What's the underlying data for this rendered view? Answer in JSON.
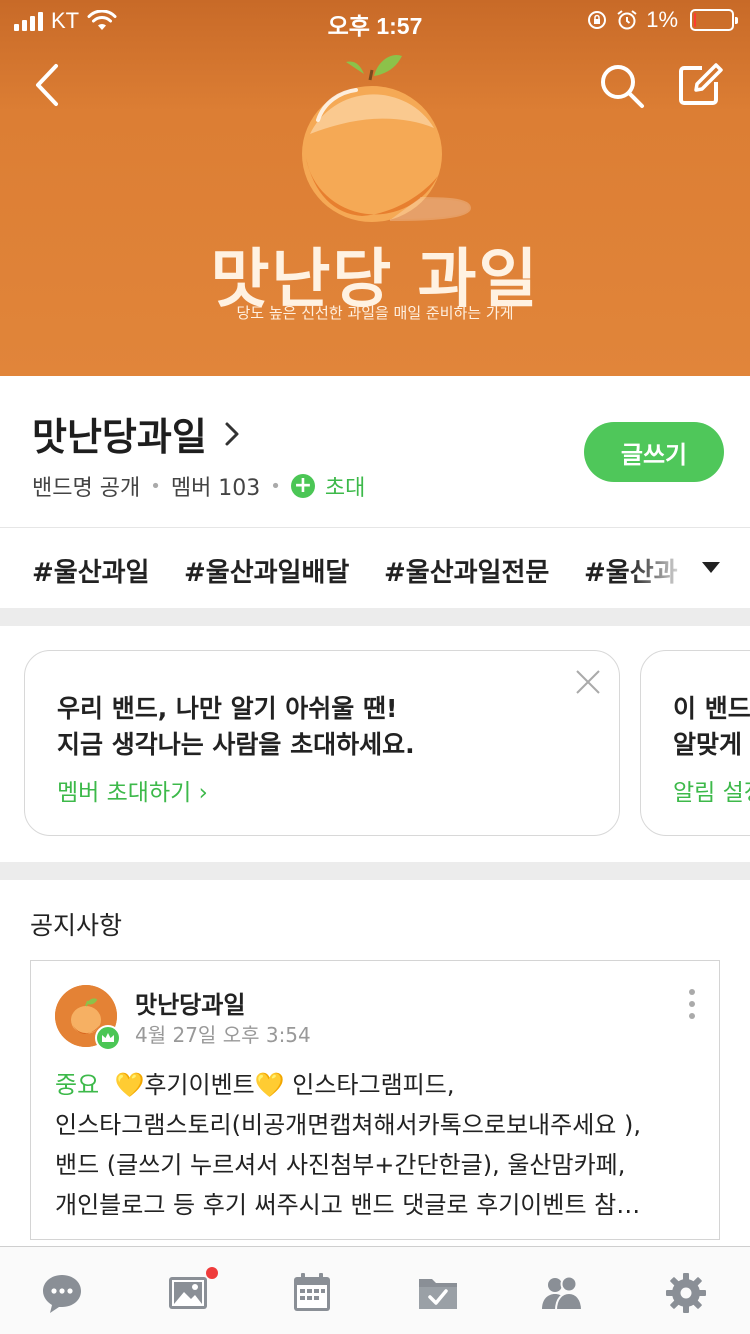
{
  "status_bar": {
    "carrier": "KT",
    "time": "오후 1:57",
    "battery": "1%"
  },
  "cover": {
    "title": "맛난당 과일",
    "subtitle": "당도 높은 신선한 과일을 매일 준비하는 가게"
  },
  "band": {
    "name": "맛난당과일",
    "visibility": "밴드명 공개",
    "members": "멤버 103",
    "invite": "초대",
    "write_button": "글쓰기"
  },
  "hashtags": [
    "#울산과일",
    "#울산과일배달",
    "#울산과일전문",
    "#울산과"
  ],
  "cards": [
    {
      "line1": "우리 밴드, 나만 알기 아쉬울 땐!",
      "line2": "지금 생각나는 사람을 초대하세요.",
      "link": "멤버 초대하기 ›"
    },
    {
      "line1": "이 밴드",
      "line2": "알맞게",
      "link": "알림 설정"
    }
  ],
  "notice": {
    "section_title": "공지사항",
    "author": "맛난당과일",
    "date": "4월 27일 오후 3:54",
    "tag": "중요",
    "heart": "💛",
    "line1_text": "후기이벤트",
    "line1_tail": " 인스타그램피드,",
    "line2": "인스타그램스토리(비공개면캡쳐해서카톡으로보내주세요 ),",
    "line3": "밴드 (글쓰기 누르셔서 사진첨부+간단한글), 울산맘카페,",
    "line4": "개인블로그 등 후기 써주시고 밴드 댓글로 후기이벤트 참…"
  },
  "tabbar": {
    "items": [
      "chat-icon",
      "photo-icon",
      "calendar-icon",
      "folder-check-icon",
      "members-icon",
      "settings-icon"
    ],
    "badge_color": "#ef3b3b"
  },
  "colors": {
    "accent_green": "#4fc75a",
    "cover_orange": "#dc7e34"
  }
}
